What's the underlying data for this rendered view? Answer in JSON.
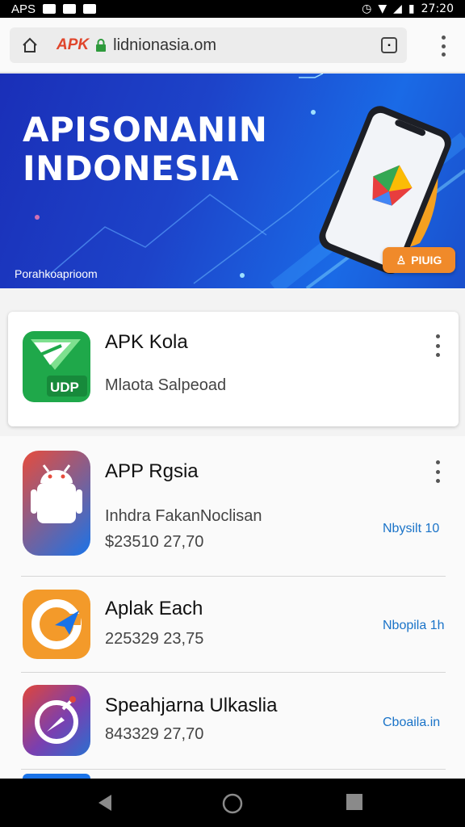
{
  "status_bar": {
    "left_label": "APS",
    "time": "27:20"
  },
  "browser": {
    "brand": "APK",
    "url": "lidnionasia.om"
  },
  "hero": {
    "title_line1": "APISONANIN",
    "title_line2": "INDONESIA",
    "url_text": "Porahkoaprioom",
    "button_label": "PIUIG"
  },
  "featured": {
    "name": "APK Kola",
    "subtitle": "Mlaota Salpeoad",
    "icon_text": "UDP"
  },
  "apps": [
    {
      "name": "APP Rgsia",
      "subtitle": "Inhdra FakanNoclisan",
      "meta": "$23510 27,70",
      "link": "Nbysilt 10"
    },
    {
      "name": "Aplak Each",
      "meta": "225329 23,75",
      "link": "Nbopila 1h"
    },
    {
      "name": "Speahjarna Ulkaslia",
      "meta": "843329 27,70",
      "link": "Cboaila.in"
    }
  ],
  "colors": {
    "accent": "#1a73c8",
    "brand": "#e0452b",
    "hero_button": "#f08a2a"
  }
}
